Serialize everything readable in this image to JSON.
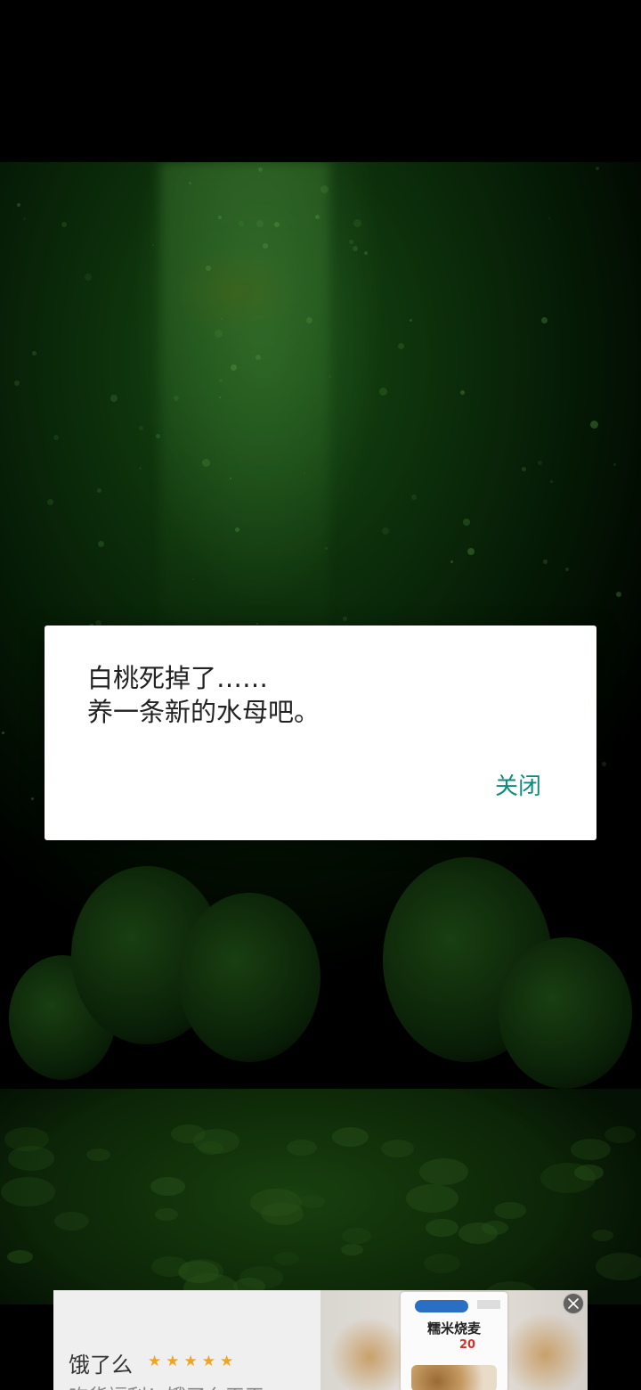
{
  "dialog": {
    "message_line1": "白桃死掉了……",
    "message_line2": "养一条新的水母吧。",
    "close_label": "关闭"
  },
  "ad": {
    "title": "饿了么",
    "rating_stars": "★★★★★",
    "subtitle": "吃货福利！饿了么天天",
    "product": {
      "name": "糯米烧麦",
      "price": "20"
    }
  },
  "colors": {
    "accent": "#0f8a7e",
    "star": "#f0a51c",
    "water": "#1c5f18"
  }
}
